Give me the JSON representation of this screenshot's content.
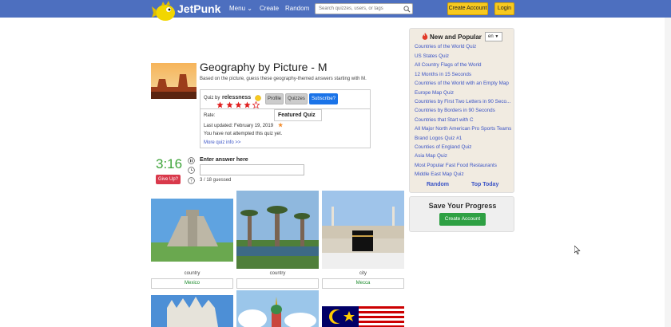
{
  "header": {
    "logo_text": "JetPunk",
    "nav": [
      {
        "label": "Menu"
      },
      {
        "label": "Create"
      },
      {
        "label": "Random"
      }
    ],
    "search": {
      "placeholder": "Search quizzes, users, or tags"
    },
    "create_account": "Create Account",
    "login": "Login"
  },
  "quiz": {
    "title": "Geography by Picture - M",
    "subtitle": "Based on the picture, guess these geography-themed answers starting with M.",
    "quiz_by_label": "Quiz by",
    "author": "relessness",
    "profile_btn": "Profile",
    "quizzes_btn": "Quizzes",
    "subscribe_btn": "Subscribe?",
    "rate_label": "Rate:",
    "rating_stars": 4,
    "rating_max": 5,
    "featured_label": "Featured Quiz",
    "last_updated": "Last updated: February 19, 2019",
    "attempt_status": "You have not attempted this quiz yet.",
    "more_info": "More quiz info >>"
  },
  "game": {
    "timer": "3:16",
    "give_up": "Give Up?",
    "enter_answer_label": "Enter answer here",
    "guessed": "3 / 18 guessed"
  },
  "pictures": [
    {
      "caption": "country",
      "answer": "Mexico"
    },
    {
      "caption": "country",
      "answer": ""
    },
    {
      "caption": "city",
      "answer": "Mecca"
    }
  ],
  "sidebar": {
    "title": "New and Popular",
    "language": "en",
    "items": [
      "Countries of the World Quiz",
      "US States Quiz",
      "All Country Flags of the World",
      "12 Months in 15 Seconds",
      "Countries of the World with an Empty Map",
      "Europe Map Quiz",
      "Countries by First Two Letters in 90 Seco...",
      "Countries by Borders in 90 Seconds",
      "Countries that Start with C",
      "All Major North American Pro Sports Teams",
      "Brand Logos Quiz #1",
      "Counties of England Quiz",
      "Asia Map Quiz",
      "Most Popular Fast Food Restaurants",
      "Middle East Map Quiz"
    ],
    "random_link": "Random",
    "top_today_link": "Top Today"
  },
  "progress": {
    "title": "Save Your Progress",
    "button": "Create Account"
  },
  "colors": {
    "header_bg": "#4d6fbf",
    "accent_yellow": "#f7c91f",
    "timer_green": "#3ea43a",
    "link_blue": "#3a53c5",
    "give_up_red": "#d9394b"
  }
}
